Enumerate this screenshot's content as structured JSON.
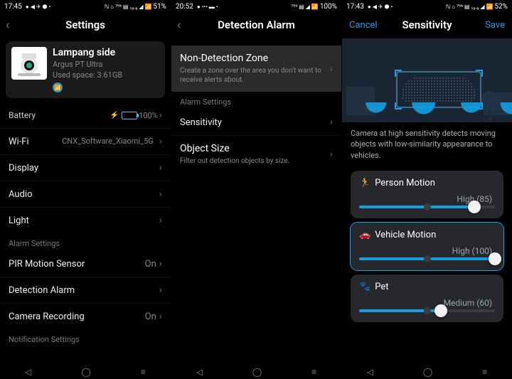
{
  "screens": [
    {
      "status": {
        "time": "17:45",
        "iconsLeft": "● ◀ ✈ ⬢ •",
        "iconsRight": "ℕ ⌂ ⁷⁵⁹ ▤ ₁₀.₀ ◢ 📶",
        "battery": "51%"
      },
      "title": "Settings",
      "device": {
        "name": "Lampang side",
        "model": "Argus PT Ultra",
        "storage": "Used space: 3.61GB"
      },
      "batteryRow": {
        "label": "Battery",
        "percent": "100%"
      },
      "wifi": {
        "label": "Wi-Fi",
        "value": "CNX_Software_Xiaomi_5G"
      },
      "rows": {
        "display": "Display",
        "audio": "Audio",
        "light": "Light"
      },
      "sections": {
        "alarm": "Alarm Settings",
        "notif": "Notification Settings"
      },
      "alarmRows": {
        "pir": {
          "label": "PIR Motion Sensor",
          "value": "On"
        },
        "detect": {
          "label": "Detection Alarm"
        },
        "rec": {
          "label": "Camera Recording",
          "value": "On"
        }
      }
    },
    {
      "status": {
        "time": "20:52",
        "iconsLeft": "● ••• ▬ •",
        "iconsRight": "⁷⁵⁹ ▤ ◢ 📶",
        "battery": "100%"
      },
      "title": "Detection Alarm",
      "ndz": {
        "title": "Non-Detection Zone",
        "sub": "Create a zone over the area you don't want to receive alerts about."
      },
      "section": "Alarm Settings",
      "sens": {
        "label": "Sensitivity"
      },
      "objsize": {
        "title": "Object Size",
        "sub": "Filter out detection objects by size."
      }
    },
    {
      "status": {
        "time": "17:43",
        "iconsLeft": "● ◀ ✈ ⬢ •",
        "iconsRight": "ℕ ⌂ ⁷⁵⁹ ▤ ₁₀.₀ ◢ 📶",
        "battery": "52%"
      },
      "cancel": "Cancel",
      "save": "Save",
      "title": "Sensitivity",
      "desc": "Camera at high sensitivity detects moving objects with low-similarity appearance to vehicles.",
      "sliders": [
        {
          "icon": "🏃",
          "label": "Person Motion",
          "levelText": "High (85)",
          "value": 85,
          "selected": false,
          "iconClass": ""
        },
        {
          "icon": "🚗",
          "label": "Vehicle Motion",
          "levelText": "High (100)",
          "value": 100,
          "selected": true,
          "iconClass": "blue"
        },
        {
          "icon": "🐾",
          "label": "Pet",
          "levelText": "Medium (60)",
          "value": 60,
          "selected": false,
          "iconClass": "green"
        }
      ]
    }
  ],
  "nav": {
    "back": "◁",
    "home": "◯",
    "menu": "≡"
  }
}
